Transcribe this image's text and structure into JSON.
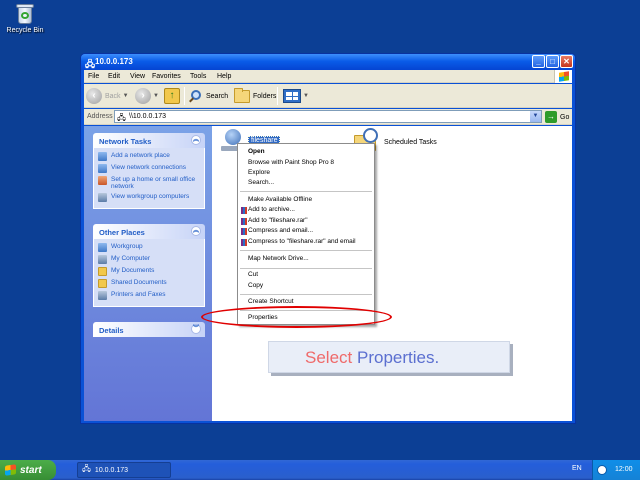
{
  "desktop": {
    "recycle_bin_label": "Recycle Bin"
  },
  "window": {
    "title": "10.0.0.173",
    "controls": {
      "minimize": "_",
      "maximize": "□",
      "close": "✕"
    },
    "menu": [
      "File",
      "Edit",
      "View",
      "Favorites",
      "Tools",
      "Help"
    ],
    "toolbar": {
      "back_label": "Back",
      "search_label": "Search",
      "folders_label": "Folders"
    },
    "address": {
      "label": "Address",
      "value": "\\\\10.0.0.173",
      "go_label": "Go"
    }
  },
  "task_pane": {
    "network_tasks": {
      "title": "Network Tasks",
      "items": [
        "Add a network place",
        "View network connections",
        "Set up a home or small office network",
        "View workgroup computers"
      ]
    },
    "other_places": {
      "title": "Other Places",
      "items": [
        "Workgroup",
        "My Computer",
        "My Documents",
        "Shared Documents",
        "Printers and Faxes"
      ]
    },
    "details": {
      "title": "Details"
    }
  },
  "files": [
    {
      "name": "fileshare",
      "icon": "network-share-icon",
      "selected": true
    },
    {
      "name": "Scheduled Tasks",
      "icon": "scheduled-tasks-icon",
      "selected": false
    }
  ],
  "context_menu": {
    "open": "Open",
    "browse_psp": "Browse with Paint Shop Pro 8",
    "explore": "Explore",
    "search": "Search...",
    "make_available_offline": "Make Available Offline",
    "add_to_archive": "Add to archive...",
    "add_to_rar": "Add to \"fileshare.rar\"",
    "compress_email": "Compress and email...",
    "compress_rar_email": "Compress to \"fileshare.rar\" and email",
    "map_network_drive": "Map Network Drive...",
    "cut": "Cut",
    "copy": "Copy",
    "create_shortcut": "Create Shortcut",
    "properties": "Properties"
  },
  "callout": {
    "word1": "Select",
    "word2": "Properties."
  },
  "taskbar": {
    "start_label": "start",
    "window_button": "10.0.0.173",
    "language": "EN",
    "clock": "12:00"
  },
  "colors": {
    "highlight_ring": "#e00000",
    "selection": "#316ac5"
  }
}
